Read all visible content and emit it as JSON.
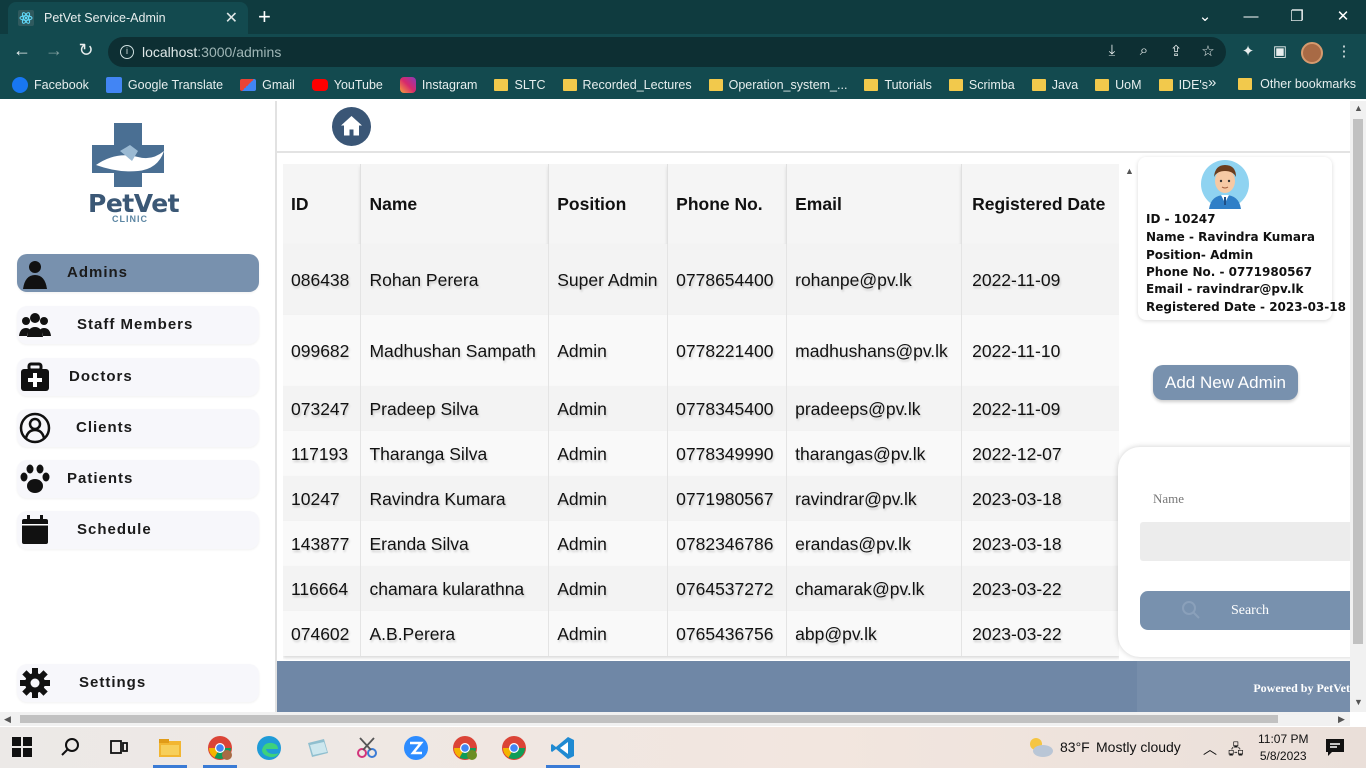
{
  "browser": {
    "tab_title": "PetVet Service-Admin",
    "url_host": "localhost",
    "url_rest": ":3000/admins",
    "bookmarks": [
      {
        "label": "Facebook",
        "icon": "facebook-icon"
      },
      {
        "label": "Google Translate",
        "icon": "google-translate-icon"
      },
      {
        "label": "Gmail",
        "icon": "gmail-icon"
      },
      {
        "label": "YouTube",
        "icon": "youtube-icon"
      },
      {
        "label": "Instagram",
        "icon": "instagram-icon"
      },
      {
        "label": "SLTC",
        "icon": "folder-icon"
      },
      {
        "label": "Recorded_Lectures",
        "icon": "folder-icon"
      },
      {
        "label": "Operation_system_...",
        "icon": "folder-icon"
      },
      {
        "label": "Tutorials",
        "icon": "folder-icon"
      },
      {
        "label": "Scrimba",
        "icon": "folder-icon"
      },
      {
        "label": "Java",
        "icon": "folder-icon"
      },
      {
        "label": "UoM",
        "icon": "folder-icon"
      },
      {
        "label": "IDE's",
        "icon": "folder-icon"
      }
    ],
    "other_bookmarks": "Other bookmarks"
  },
  "logo": {
    "title": "PetVet",
    "subtitle": "CLINIC"
  },
  "sidebar": {
    "items": [
      {
        "label": "Admins",
        "icon": "person-icon",
        "active": true
      },
      {
        "label": "Staff Members",
        "icon": "group-icon",
        "active": false
      },
      {
        "label": "Doctors",
        "icon": "medical-kit-icon",
        "active": false
      },
      {
        "label": "Clients",
        "icon": "user-circle-icon",
        "active": false
      },
      {
        "label": "Patients",
        "icon": "paw-icon",
        "active": false
      },
      {
        "label": "Schedule",
        "icon": "calendar-icon",
        "active": false
      }
    ],
    "settings_label": "Settings"
  },
  "table": {
    "headers": [
      "ID",
      "Name",
      "Position",
      "Phone No.",
      "Email",
      "Registered Date"
    ],
    "rows": [
      [
        "086438",
        "Rohan Perera",
        "Super Admin",
        "0778654400",
        "rohanpe@pv.lk",
        "2022-11-09"
      ],
      [
        "099682",
        "Madhushan Sampath",
        "Admin",
        "0778221400",
        "madhushans@pv.lk",
        "2022-11-10"
      ],
      [
        "073247",
        "Pradeep Silva",
        "Admin",
        "0778345400",
        "pradeeps@pv.lk",
        "2022-11-09"
      ],
      [
        "117193",
        "Tharanga Silva",
        "Admin",
        "0778349990",
        "tharangas@pv.lk",
        "2022-12-07"
      ],
      [
        "10247",
        "Ravindra Kumara",
        "Admin",
        "0771980567",
        "ravindrar@pv.lk",
        "2023-03-18"
      ],
      [
        "143877",
        "Eranda Silva",
        "Admin",
        "0782346786",
        "erandas@pv.lk",
        "2023-03-18"
      ],
      [
        "116664",
        "chamara kularathna",
        "Admin",
        "0764537272",
        "chamarak@pv.lk",
        "2023-03-22"
      ],
      [
        "074602",
        "A.B.Perera",
        "Admin",
        "0765436756",
        "abp@pv.lk",
        "2023-03-22"
      ]
    ]
  },
  "profile": {
    "id": "ID - 10247",
    "name": "Name - Ravindra Kumara",
    "position": "Position- Admin",
    "phone": "Phone No. - 0771980567",
    "email": "Email - ravindrar@pv.lk",
    "registered": "Registered Date - 2023-03-18"
  },
  "add_button": "Add New Admin",
  "search": {
    "label": "Name",
    "value": "",
    "button": "Search"
  },
  "footer": {
    "text": "Powered by PetVet"
  },
  "taskbar": {
    "weather": "83°F",
    "weather_desc": "Mostly cloudy",
    "time": "11:07 PM",
    "date": "5/8/2023"
  },
  "colors": {
    "accent": "#7891ae",
    "dark_accent": "#3a5676",
    "chrome": "#134a4f"
  }
}
